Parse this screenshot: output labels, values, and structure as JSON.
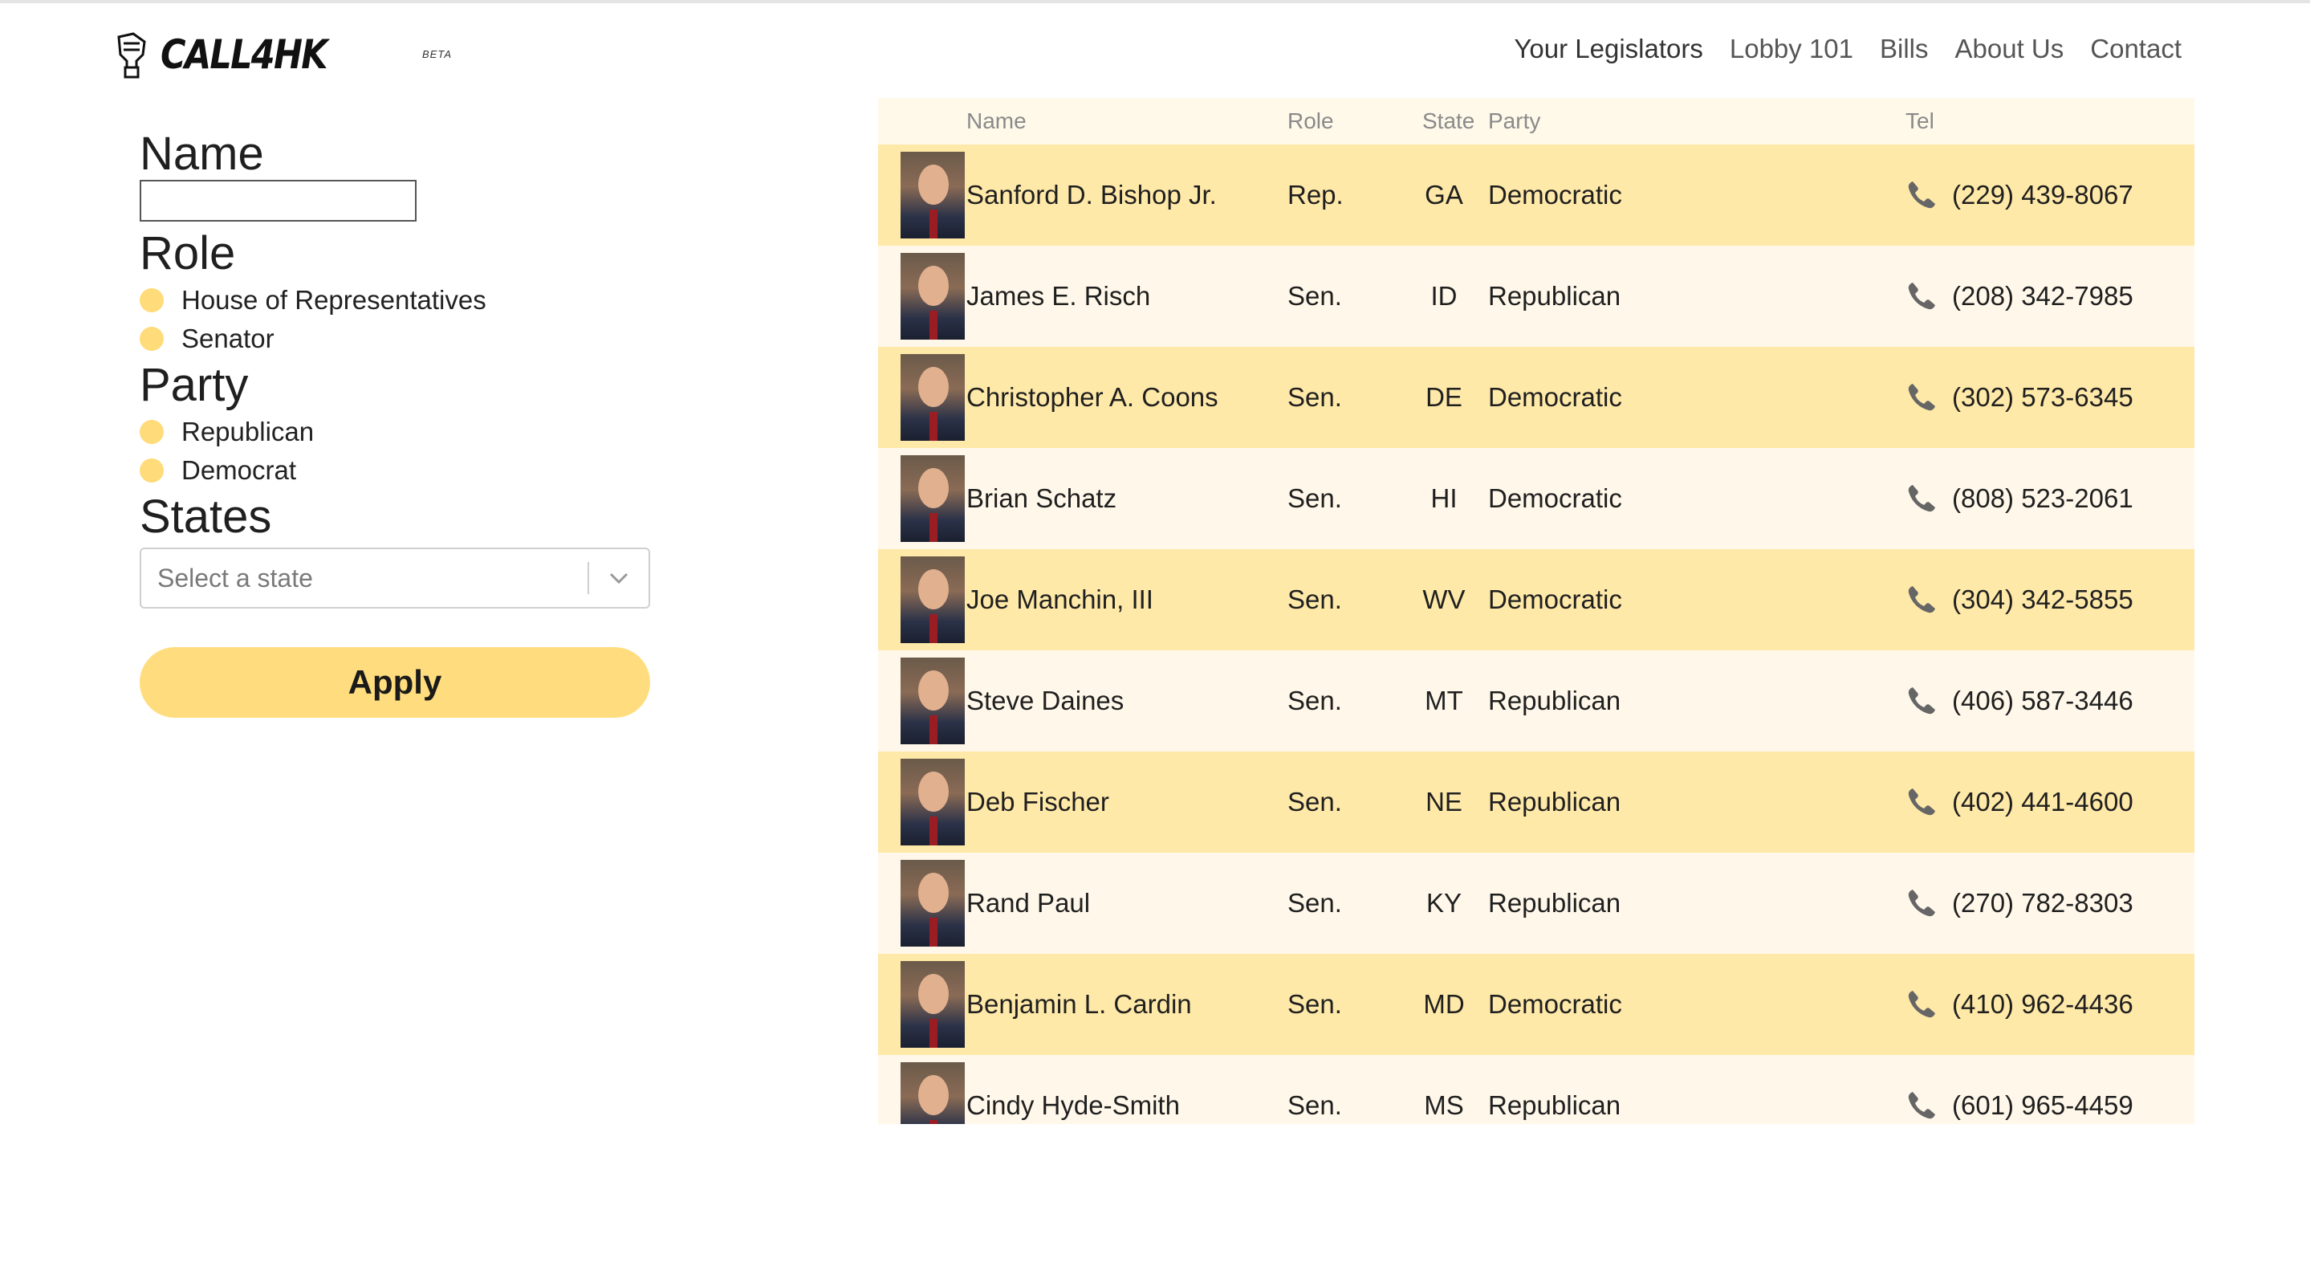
{
  "brand": {
    "name": "CALL4HK",
    "badge": "BETA"
  },
  "nav": [
    "Your Legislators",
    "Lobby 101",
    "Bills",
    "About Us",
    "Contact"
  ],
  "filters": {
    "name_heading": "Name",
    "name_value": "",
    "role_heading": "Role",
    "roles": [
      "House of Representatives",
      "Senator"
    ],
    "party_heading": "Party",
    "parties": [
      "Republican",
      "Democrat"
    ],
    "states_heading": "States",
    "state_placeholder": "Select a state",
    "apply_label": "Apply"
  },
  "table": {
    "columns": [
      "Name",
      "Role",
      "State",
      "Party",
      "Tel"
    ],
    "rows": [
      {
        "name": "Sanford D. Bishop Jr.",
        "role": "Rep.",
        "state": "GA",
        "party": "Democratic",
        "tel": "(229) 439-8067"
      },
      {
        "name": "James E. Risch",
        "role": "Sen.",
        "state": "ID",
        "party": "Republican",
        "tel": "(208) 342-7985"
      },
      {
        "name": "Christopher A. Coons",
        "role": "Sen.",
        "state": "DE",
        "party": "Democratic",
        "tel": "(302) 573-6345"
      },
      {
        "name": "Brian Schatz",
        "role": "Sen.",
        "state": "HI",
        "party": "Democratic",
        "tel": "(808) 523-2061"
      },
      {
        "name": "Joe Manchin, III",
        "role": "Sen.",
        "state": "WV",
        "party": "Democratic",
        "tel": "(304) 342-5855"
      },
      {
        "name": "Steve Daines",
        "role": "Sen.",
        "state": "MT",
        "party": "Republican",
        "tel": "(406) 587-3446"
      },
      {
        "name": "Deb Fischer",
        "role": "Sen.",
        "state": "NE",
        "party": "Republican",
        "tel": "(402) 441-4600"
      },
      {
        "name": "Rand Paul",
        "role": "Sen.",
        "state": "KY",
        "party": "Republican",
        "tel": "(270) 782-8303"
      },
      {
        "name": "Benjamin L. Cardin",
        "role": "Sen.",
        "state": "MD",
        "party": "Democratic",
        "tel": "(410) 962-4436"
      },
      {
        "name": "Cindy Hyde-Smith",
        "role": "Sen.",
        "state": "MS",
        "party": "Republican",
        "tel": "(601) 965-4459"
      }
    ]
  },
  "colors": {
    "accent": "#ffdd7e",
    "row_alt": "#ffe9a8",
    "row_base": "#fff8ea"
  },
  "icons": {
    "logo": "fist-mascot-icon",
    "phone": "phone-icon",
    "dropdown": "chevron-down-icon"
  }
}
